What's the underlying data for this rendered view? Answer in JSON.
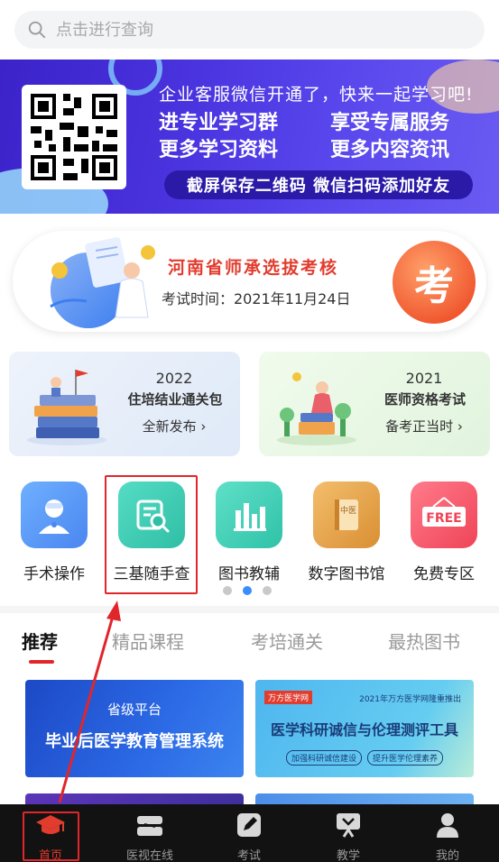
{
  "search": {
    "placeholder": "点击进行查询"
  },
  "banner": {
    "line1": "企业客服微信开通了，快来一起学习吧!",
    "items": [
      "进专业学习群",
      "享受专属服务",
      "更多学习资料",
      "更多内容资讯"
    ],
    "pill": "截屏保存二维码 微信扫码添加好友"
  },
  "exam": {
    "title": "河南省师承选拔考核",
    "date": "考试时间：2021年11月24日",
    "badge": "考"
  },
  "promos": [
    {
      "year": "2022",
      "title": "住培结业通关包",
      "action": "全新发布 ›"
    },
    {
      "year": "2021",
      "title": "医师资格考试",
      "action": "备考正当时 ›"
    }
  ],
  "grid": [
    {
      "label": "手术操作",
      "icon": "doctor-icon",
      "color": "#5a9cf5"
    },
    {
      "label": "三基随手查",
      "icon": "search-doc-icon",
      "color": "#3ccdb3"
    },
    {
      "label": "图书教辅",
      "icon": "bar-chart-icon",
      "color": "#3fd0b8"
    },
    {
      "label": "数字图书馆",
      "icon": "book-icon",
      "color": "#e9a44a"
    },
    {
      "label": "免费专区",
      "icon": "free-sign-icon",
      "color": "#f4556a"
    }
  ],
  "grid_free_text": "FREE",
  "book_text": "中医",
  "tabs": [
    "推荐",
    "精品课程",
    "考培通关",
    "最热图书"
  ],
  "courses": [
    {
      "t1": "省级平台",
      "t2": "毕业后医学教育管理系统"
    },
    {
      "logo": "万方医学网",
      "sub": "2021年万方医学网隆重推出",
      "t2": "医学科研诚信与伦理测评工具",
      "tags": [
        "加强科研诚信建设",
        "提升医学伦理素养"
      ]
    }
  ],
  "bottom_nav": [
    {
      "label": "首页",
      "icon": "graduation-cap-icon",
      "active": true
    },
    {
      "label": "医视在线",
      "icon": "video-stack-icon",
      "active": false
    },
    {
      "label": "考试",
      "icon": "pen-edit-icon",
      "active": false
    },
    {
      "label": "教学",
      "icon": "teaching-board-icon",
      "active": false
    },
    {
      "label": "我的",
      "icon": "user-icon",
      "active": false
    }
  ],
  "colors": {
    "accent_red": "#e0262a",
    "banner_blue": "#4b35e0",
    "exam_orange": "#f0562e",
    "dot_active": "#3b8cff"
  }
}
